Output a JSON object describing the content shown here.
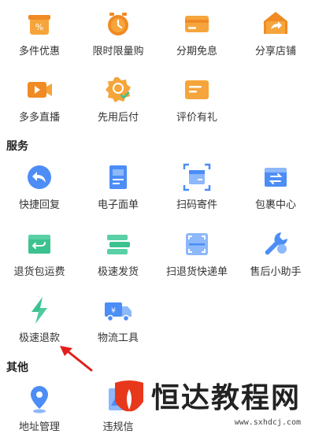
{
  "promo": {
    "row1": [
      {
        "label": "多件优惠",
        "icon": "discount-tag-icon"
      },
      {
        "label": "限时限量购",
        "icon": "alarm-clock-icon"
      },
      {
        "label": "分期免息",
        "icon": "credit-card-icon"
      },
      {
        "label": "分享店铺",
        "icon": "share-store-icon"
      }
    ],
    "row2": [
      {
        "label": "多多直播",
        "icon": "live-video-icon"
      },
      {
        "label": "先用后付",
        "icon": "pay-later-badge-icon"
      },
      {
        "label": "评价有礼",
        "icon": "review-gift-icon"
      }
    ]
  },
  "services": {
    "title": "服务",
    "row1": [
      {
        "label": "快捷回复",
        "icon": "quick-reply-icon"
      },
      {
        "label": "电子面单",
        "icon": "electronic-waybill-icon"
      },
      {
        "label": "扫码寄件",
        "icon": "scan-ship-icon"
      },
      {
        "label": "包裹中心",
        "icon": "package-center-icon"
      }
    ],
    "row2": [
      {
        "label": "退货包运费",
        "icon": "return-shipping-icon"
      },
      {
        "label": "极速发货",
        "icon": "fast-shipping-icon"
      },
      {
        "label": "扫退货快递单",
        "icon": "scan-return-icon"
      },
      {
        "label": "售后小助手",
        "icon": "wrench-icon"
      }
    ],
    "row3": [
      {
        "label": "极速退款",
        "icon": "lightning-icon"
      },
      {
        "label": "物流工具",
        "icon": "delivery-truck-icon"
      }
    ]
  },
  "other": {
    "title": "其他",
    "row1": [
      {
        "label": "地址管理",
        "icon": "location-pin-icon"
      },
      {
        "label": "违规信",
        "icon": "warning-icon"
      }
    ]
  },
  "watermark": {
    "text": "恒达教程网",
    "url": "www.sxhdcj.com"
  },
  "colors": {
    "orange": "#F5A53B",
    "orange_dark": "#F08A24",
    "blue": "#4C8DF6",
    "blue_light": "#8DB8FA",
    "green": "#3CC28F",
    "teal": "#5AD0A6",
    "arrow": "#E0201C"
  }
}
